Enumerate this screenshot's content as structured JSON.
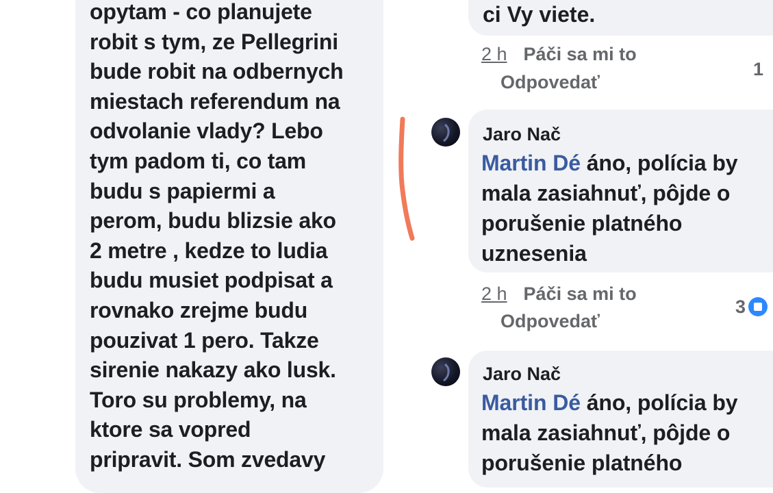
{
  "left_comment": {
    "text": "opytam - co planujete\nrobit s tym, ze Pellegrini\nbude robit na odbernych\nmiestach referendum na\nodvolanie vlady? Lebo\ntym padom ti, co tam\nbudu s papiermi a\nperom, budu blizsie ako\n2 metre  , kedze to ludia\nbudu musiet podpisat a\nrovnako zrejme budu\npouzivat 1 pero. Takze\nsirenie nakazy ako lusk.\nToro su problemy, na\nktore sa vopred\npripravit. Som zvedavy"
  },
  "top_reply": {
    "text": "ci Vy viete.",
    "time": "2 h",
    "like_label": "Páči sa mi to",
    "reply_label": "Odpovedať",
    "reaction_count": "1"
  },
  "replies": [
    {
      "author": "Jaro Nač",
      "mention": "Martin Dé",
      "text_line1": " áno, polícia by",
      "text_rest": "mala zasiahnuť, pôjde o porušenie platného uznesenia",
      "time": "2 h",
      "like_label": "Páči sa mi to",
      "reply_label": "Odpovedať",
      "reaction_count": "3"
    },
    {
      "author": "Jaro Nač",
      "mention": "Martin Dé",
      "text_line1": " áno, polícia by",
      "text_rest": "mala zasiahnuť, pôjde o porušenie platného"
    }
  ],
  "colors": {
    "bubble": "#f0f2f5",
    "mention": "#3a5ba0",
    "meta": "#65676b",
    "annotation": "#f07a5a",
    "like": "#2d88ff"
  },
  "icons": {
    "avatar": "avatar",
    "reaction": "like-icon"
  }
}
